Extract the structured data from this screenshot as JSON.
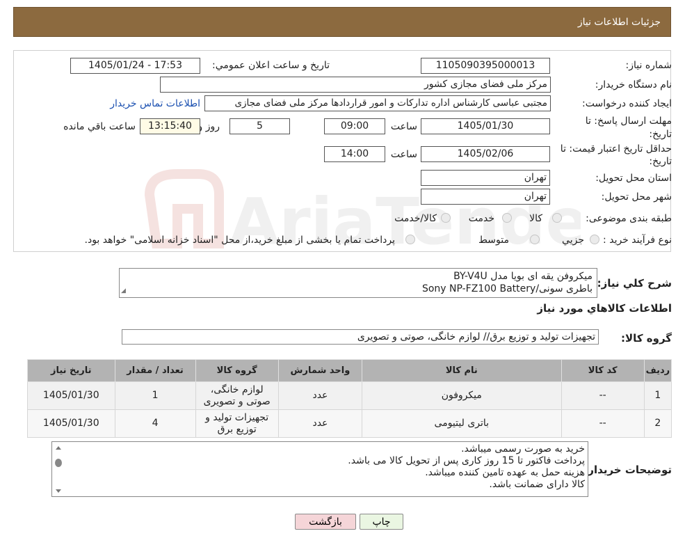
{
  "header": {
    "title": "جزئیات اطلاعات نیاز"
  },
  "form": {
    "need_number_label": "شماره نیاز:",
    "need_number": "1105090395000013",
    "announce_label": "تاریخ و ساعت اعلان عمومي:",
    "announce_value": "1405/01/24 - 17:53",
    "buyer_org_label": "نام دستگاه خريدار:",
    "buyer_org": "مرکز ملی فضای مجازی کشور",
    "creator_label": "ايجاد کننده درخواست:",
    "creator": "مجتبی عباسی کارشناس اداره تدارکات و امور قراردادها مرکز ملی فضای مجازی",
    "contact_link": "اطلاعات تماس خريدار",
    "deadline_label_1": "مهلت ارسال پاسخ: تا",
    "deadline_label_2": "تاريخ:",
    "deadline_date": "1405/01/30",
    "time_label": "ساعت",
    "deadline_time": "09:00",
    "days_value": "5",
    "days_label": "روز و",
    "remaining_time": "13:15:40",
    "remaining_label": "ساعت باقي مانده",
    "validity_label_1": "حداقل تاريخ اعتبار قيمت: تا",
    "validity_label_2": "تاريخ:",
    "validity_date": "1405/02/06",
    "validity_time": "14:00",
    "province_label": "استان محل تحويل:",
    "province": "تهران",
    "city_label": "شهر محل تحويل:",
    "city": "تهران",
    "category_label": "طبقه بندی موضوعی:",
    "category_options": [
      "کالا",
      "خدمت",
      "کالا/خدمت"
    ],
    "process_label": "نوع فرآيند خريد :",
    "process_options": [
      "جزيي",
      "متوسط"
    ],
    "process_note": "پرداخت تمام يا بخشی از مبلغ خريد،از محل \"اسناد خزانه اسلامی\" خواهد بود."
  },
  "summary": {
    "label": "شرح کلي نياز:",
    "lines": [
      "میکروفن یقه ای بویا مدل BY-V4U",
      "باطری سونی/Sony NP-FZ100 Battery"
    ]
  },
  "goods": {
    "section_title": "اطلاعات کالاهاي مورد نياز",
    "group_label": "گروه کالا:",
    "group_value": "تجهیزات تولید و توزیع برق// لوازم خانگی، صوتی و تصویری"
  },
  "table": {
    "headers": [
      "رديف",
      "کد کالا",
      "نام کالا",
      "واحد شمارش",
      "گروه کالا",
      "تعداد / مقدار",
      "تاريخ نياز"
    ],
    "rows": [
      {
        "idx": "1",
        "code": "--",
        "name": "میکروفون",
        "unit": "عدد",
        "group_1": "لوازم خانگی،",
        "group_2": "صوتی و تصویری",
        "qty": "1",
        "date": "1405/01/30"
      },
      {
        "idx": "2",
        "code": "--",
        "name": "باتری لیتیومی",
        "unit": "عدد",
        "group_1": "تجهیزات تولید و",
        "group_2": "توزیع برق",
        "qty": "4",
        "date": "1405/01/30"
      }
    ]
  },
  "notes": {
    "label": "توضيحات خريدار:",
    "lines": [
      "خرید به صورت رسمی میباشد.",
      "پرداخت فاکتور تا 15 روز کاری پس از تحویل کالا می باشد.",
      "هزینه حمل به عهده تامین کننده میباشد.",
      "کالا دارای ضمانت باشد."
    ]
  },
  "buttons": {
    "print": "چاپ",
    "back": "بازگشت"
  },
  "watermark": {
    "text": "AriaTender.neT"
  },
  "colors": {
    "header_bg": "#8c6a3f",
    "link": "#1a4fb0",
    "back_button": "#f5d5d8",
    "print_button": "#eaf6e2"
  }
}
